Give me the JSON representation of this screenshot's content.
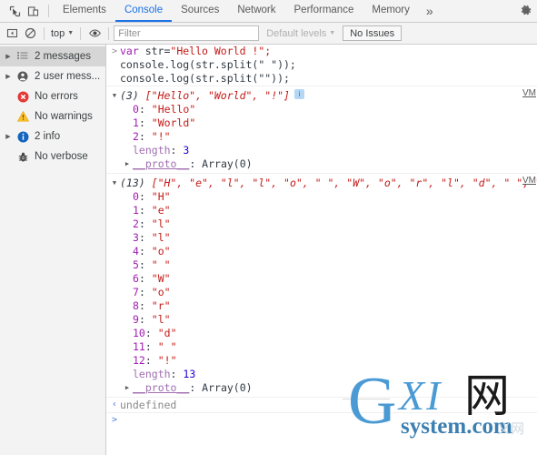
{
  "window": {
    "tab_icons": [
      {
        "name": "inspect-element-icon",
        "glyph": "⬚"
      },
      {
        "name": "device-toolbar-icon",
        "glyph": "❐"
      }
    ],
    "tabs": [
      {
        "label": "Elements",
        "active": false
      },
      {
        "label": "Console",
        "active": true
      },
      {
        "label": "Sources",
        "active": false
      },
      {
        "label": "Network",
        "active": false
      },
      {
        "label": "Performance",
        "active": false
      },
      {
        "label": "Memory",
        "active": false
      }
    ],
    "more_tabs_label": "»",
    "settings_icon": "gear-icon"
  },
  "console_toolbar": {
    "sidebar_toggle_icon": "sidebar-toggle-icon",
    "clear_console_icon": "clear-console-icon",
    "context_label": "top",
    "context_caret": "▼",
    "eye_icon": "eye-icon",
    "filter_placeholder": "Filter",
    "filter_value": "",
    "levels_label": "Default levels",
    "levels_caret": "▼",
    "issues_label": "No Issues"
  },
  "sidebar": {
    "items": [
      {
        "label": "2 messages",
        "icon": "list-icon",
        "twisty": true,
        "selected": true
      },
      {
        "label": "2 user mess...",
        "icon": "user-icon",
        "twisty": true,
        "selected": false
      },
      {
        "label": "No errors",
        "icon": "error-icon",
        "twisty": false,
        "selected": false
      },
      {
        "label": "No warnings",
        "icon": "warning-icon",
        "twisty": false,
        "selected": false
      },
      {
        "label": "2 info",
        "icon": "info-icon",
        "twisty": true,
        "selected": false
      },
      {
        "label": "No verbose",
        "icon": "bug-icon",
        "twisty": false,
        "selected": false
      }
    ]
  },
  "console": {
    "input_prompt": ">",
    "input_lines": [
      {
        "parts": [
          {
            "t": "var ",
            "c": "kw"
          },
          {
            "t": "str=",
            "c": "plain"
          },
          {
            "t": "\"Hello World !\";",
            "c": "str"
          }
        ]
      },
      {
        "parts": [
          {
            "t": "console.log(str.split(\" \"));",
            "c": "plain"
          }
        ]
      },
      {
        "parts": [
          {
            "t": "console.log(str.split(\"\"));",
            "c": "plain"
          }
        ]
      }
    ],
    "outputs": [
      {
        "twisty": "▼",
        "count": "(3)",
        "preview": "[\"Hello\", \"World\", \"!\"]",
        "badge": "i",
        "vm_label": "VM",
        "props": [
          {
            "key": "0",
            "value": "\"Hello\"",
            "kind": "string"
          },
          {
            "key": "1",
            "value": "\"World\"",
            "kind": "string"
          },
          {
            "key": "2",
            "value": "\"!\"",
            "kind": "string"
          },
          {
            "key": "length",
            "value": "3",
            "kind": "number"
          }
        ],
        "proto_twisty": "▶",
        "proto_key": "__proto__",
        "proto_value": "Array(0)"
      },
      {
        "twisty": "▼",
        "count": "(13)",
        "preview": "[\"H\", \"e\", \"l\", \"l\", \"o\", \" \", \"W\", \"o\", \"r\", \"l\", \"d\", \" \", \"!\"]",
        "badge": "i",
        "vm_label": "VM",
        "props": [
          {
            "key": "0",
            "value": "\"H\"",
            "kind": "string"
          },
          {
            "key": "1",
            "value": "\"e\"",
            "kind": "string"
          },
          {
            "key": "2",
            "value": "\"l\"",
            "kind": "string"
          },
          {
            "key": "3",
            "value": "\"l\"",
            "kind": "string"
          },
          {
            "key": "4",
            "value": "\"o\"",
            "kind": "string"
          },
          {
            "key": "5",
            "value": "\" \"",
            "kind": "string"
          },
          {
            "key": "6",
            "value": "\"W\"",
            "kind": "string"
          },
          {
            "key": "7",
            "value": "\"o\"",
            "kind": "string"
          },
          {
            "key": "8",
            "value": "\"r\"",
            "kind": "string"
          },
          {
            "key": "9",
            "value": "\"l\"",
            "kind": "string"
          },
          {
            "key": "10",
            "value": "\"d\"",
            "kind": "string"
          },
          {
            "key": "11",
            "value": "\" \"",
            "kind": "string"
          },
          {
            "key": "12",
            "value": "\"!\"",
            "kind": "string"
          },
          {
            "key": "length",
            "value": "13",
            "kind": "number"
          }
        ],
        "proto_twisty": "▶",
        "proto_key": "__proto__",
        "proto_value": "Array(0)"
      }
    ],
    "return_arrow": "‹",
    "return_value": "undefined",
    "final_prompt": ">"
  },
  "watermark": {
    "g": "G",
    "xi": "XI",
    "cjk": "网",
    "system": "system.com",
    "ghost": "义网"
  }
}
